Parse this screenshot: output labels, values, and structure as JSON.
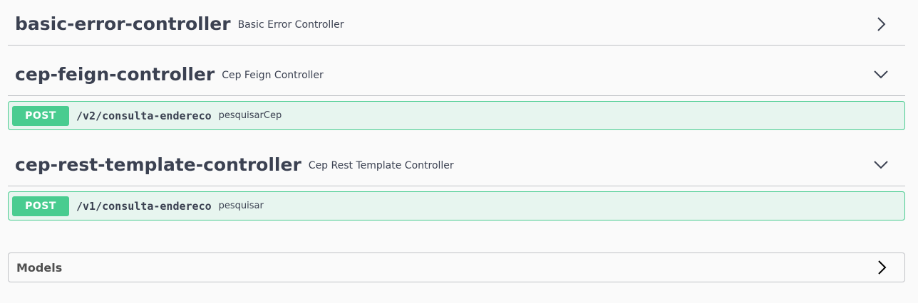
{
  "tags": [
    {
      "name": "basic-error-controller",
      "description": "Basic Error Controller",
      "expanded": false,
      "chevron_icon": "chevron-right-icon"
    },
    {
      "name": "cep-feign-controller",
      "description": "Cep Feign Controller",
      "expanded": true,
      "chevron_icon": "chevron-down-icon",
      "operations": [
        {
          "method": "POST",
          "path": "/v2/consulta-endereco",
          "summary": "pesquisarCep"
        }
      ]
    },
    {
      "name": "cep-rest-template-controller",
      "description": "Cep Rest Template Controller",
      "expanded": true,
      "chevron_icon": "chevron-down-icon",
      "operations": [
        {
          "method": "POST",
          "path": "/v1/consulta-endereco",
          "summary": "pesquisar"
        }
      ]
    }
  ],
  "models": {
    "title": "Models",
    "chevron_icon": "chevron-right-icon"
  },
  "colors": {
    "post": "#49cc90",
    "text": "#3b4151",
    "background": "#fafafa"
  }
}
